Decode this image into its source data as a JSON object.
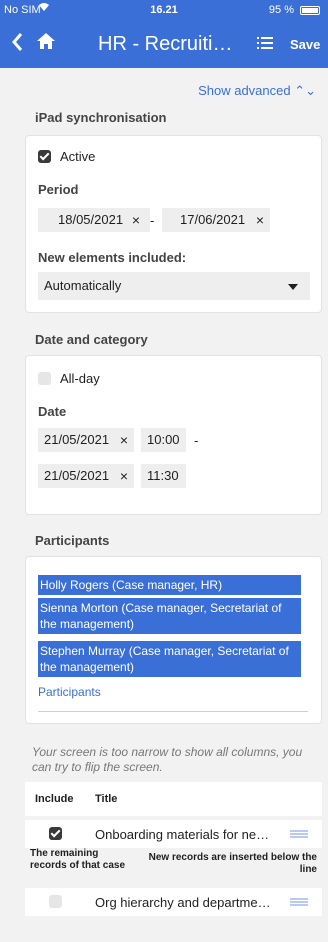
{
  "status": {
    "carrier": "No SIM",
    "time": "16.21",
    "battery": "95 %"
  },
  "nav": {
    "back_icon": "chevron-left-icon",
    "home_icon": "home-icon",
    "title": "HR - Recruiti…",
    "list_icon": "list-icon",
    "save": "Save"
  },
  "show_advanced": "Show advanced ⌃⌄",
  "ipad": {
    "title": "iPad synchronisation",
    "active_label": "Active",
    "active": true,
    "period_label": "Period",
    "period_from": "18/05/2021",
    "period_to": "17/06/2021",
    "dash": "-",
    "new_elements_label": "New elements included:",
    "new_elements_value": "Automatically"
  },
  "date_category": {
    "title": "Date and category",
    "allday_label": "All-day",
    "allday": false,
    "date_label": "Date",
    "start_date": "21/05/2021",
    "start_time": "10:00",
    "dash": "-",
    "end_date": "21/05/2021",
    "end_time": "11:30"
  },
  "participants": {
    "title": "Participants",
    "items": [
      "Holly Rogers (Case manager, HR)",
      "Sienna Morton (Case manager, Secretariat of the management)",
      "Stephen Murray (Case manager, Secretariat of the management)"
    ],
    "link": "Participants"
  },
  "narrow_note": "Your screen is too narrow to show all columns, you can try to flip the screen.",
  "table": {
    "col_include": "Include",
    "col_title": "Title",
    "rows": [
      {
        "title": "Onboarding materials for ne…",
        "include": true
      },
      {
        "title": "Org hierarchy and departme…",
        "include": false
      }
    ],
    "remaining_note": "The remaining records of that case",
    "inserted_note": "New records are inserted below the line"
  },
  "colors": {
    "accent": "#3a6fd8",
    "background": "#f2f2f2"
  },
  "icons": {
    "remove": "×"
  }
}
